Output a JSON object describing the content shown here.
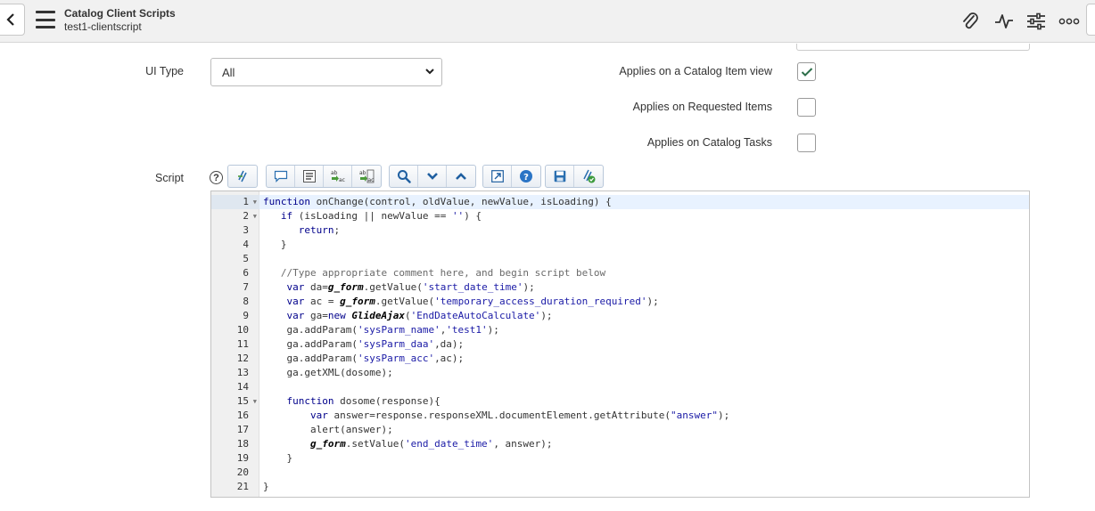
{
  "header": {
    "title": "Catalog Client Scripts",
    "subtitle": "test1-clientscript",
    "icons": [
      "paperclip-icon",
      "activity-icon",
      "sliders-icon",
      "more-icon"
    ]
  },
  "form": {
    "ui_type_label": "UI Type",
    "ui_type_value": "All",
    "applies_catalog_item_label": "Applies on a Catalog Item view",
    "applies_catalog_item_checked": true,
    "applies_requested_items_label": "Applies on Requested Items",
    "applies_requested_items_checked": false,
    "applies_catalog_tasks_label": "Applies on Catalog Tasks",
    "applies_catalog_tasks_checked": false,
    "script_label": "Script",
    "help_symbol": "?"
  },
  "toolbar": {
    "buttons": [
      "syntax-check-icon",
      "comment-icon",
      "format-icon",
      "replace-icon",
      "replace-all-icon",
      "search-icon",
      "next-icon",
      "previous-icon",
      "fullscreen-icon",
      "help-icon",
      "save-icon",
      "validate-icon"
    ]
  },
  "editor": {
    "accent": "#1a1aa6",
    "lines": [
      {
        "n": "1",
        "text": "function onChange(control, oldValue, newValue, isLoading) {"
      },
      {
        "n": "2",
        "text": "   if (isLoading || newValue == '') {"
      },
      {
        "n": "3",
        "text": "      return;"
      },
      {
        "n": "4",
        "text": "   }"
      },
      {
        "n": "5",
        "text": ""
      },
      {
        "n": "6",
        "text": "   //Type appropriate comment here, and begin script below"
      },
      {
        "n": "7",
        "text": "    var da=g_form.getValue('start_date_time');"
      },
      {
        "n": "8",
        "text": "    var ac = g_form.getValue('temporary_access_duration_required');"
      },
      {
        "n": "9",
        "text": "    var ga=new GlideAjax('EndDateAutoCalculate');"
      },
      {
        "n": "10",
        "text": "    ga.addParam('sysParm_name','test1');"
      },
      {
        "n": "11",
        "text": "    ga.addParam('sysParm_daa',da);"
      },
      {
        "n": "12",
        "text": "    ga.addParam('sysParm_acc',ac);"
      },
      {
        "n": "13",
        "text": "    ga.getXML(dosome);"
      },
      {
        "n": "14",
        "text": ""
      },
      {
        "n": "15",
        "text": "    function dosome(response){"
      },
      {
        "n": "16",
        "text": "        var answer=response.responseXML.documentElement.getAttribute(\"answer\");"
      },
      {
        "n": "17",
        "text": "        alert(answer);"
      },
      {
        "n": "18",
        "text": "        g_form.setValue('end_date_time', answer);"
      },
      {
        "n": "19",
        "text": "    }"
      },
      {
        "n": "20",
        "text": ""
      },
      {
        "n": "21",
        "text": "}"
      }
    ]
  }
}
